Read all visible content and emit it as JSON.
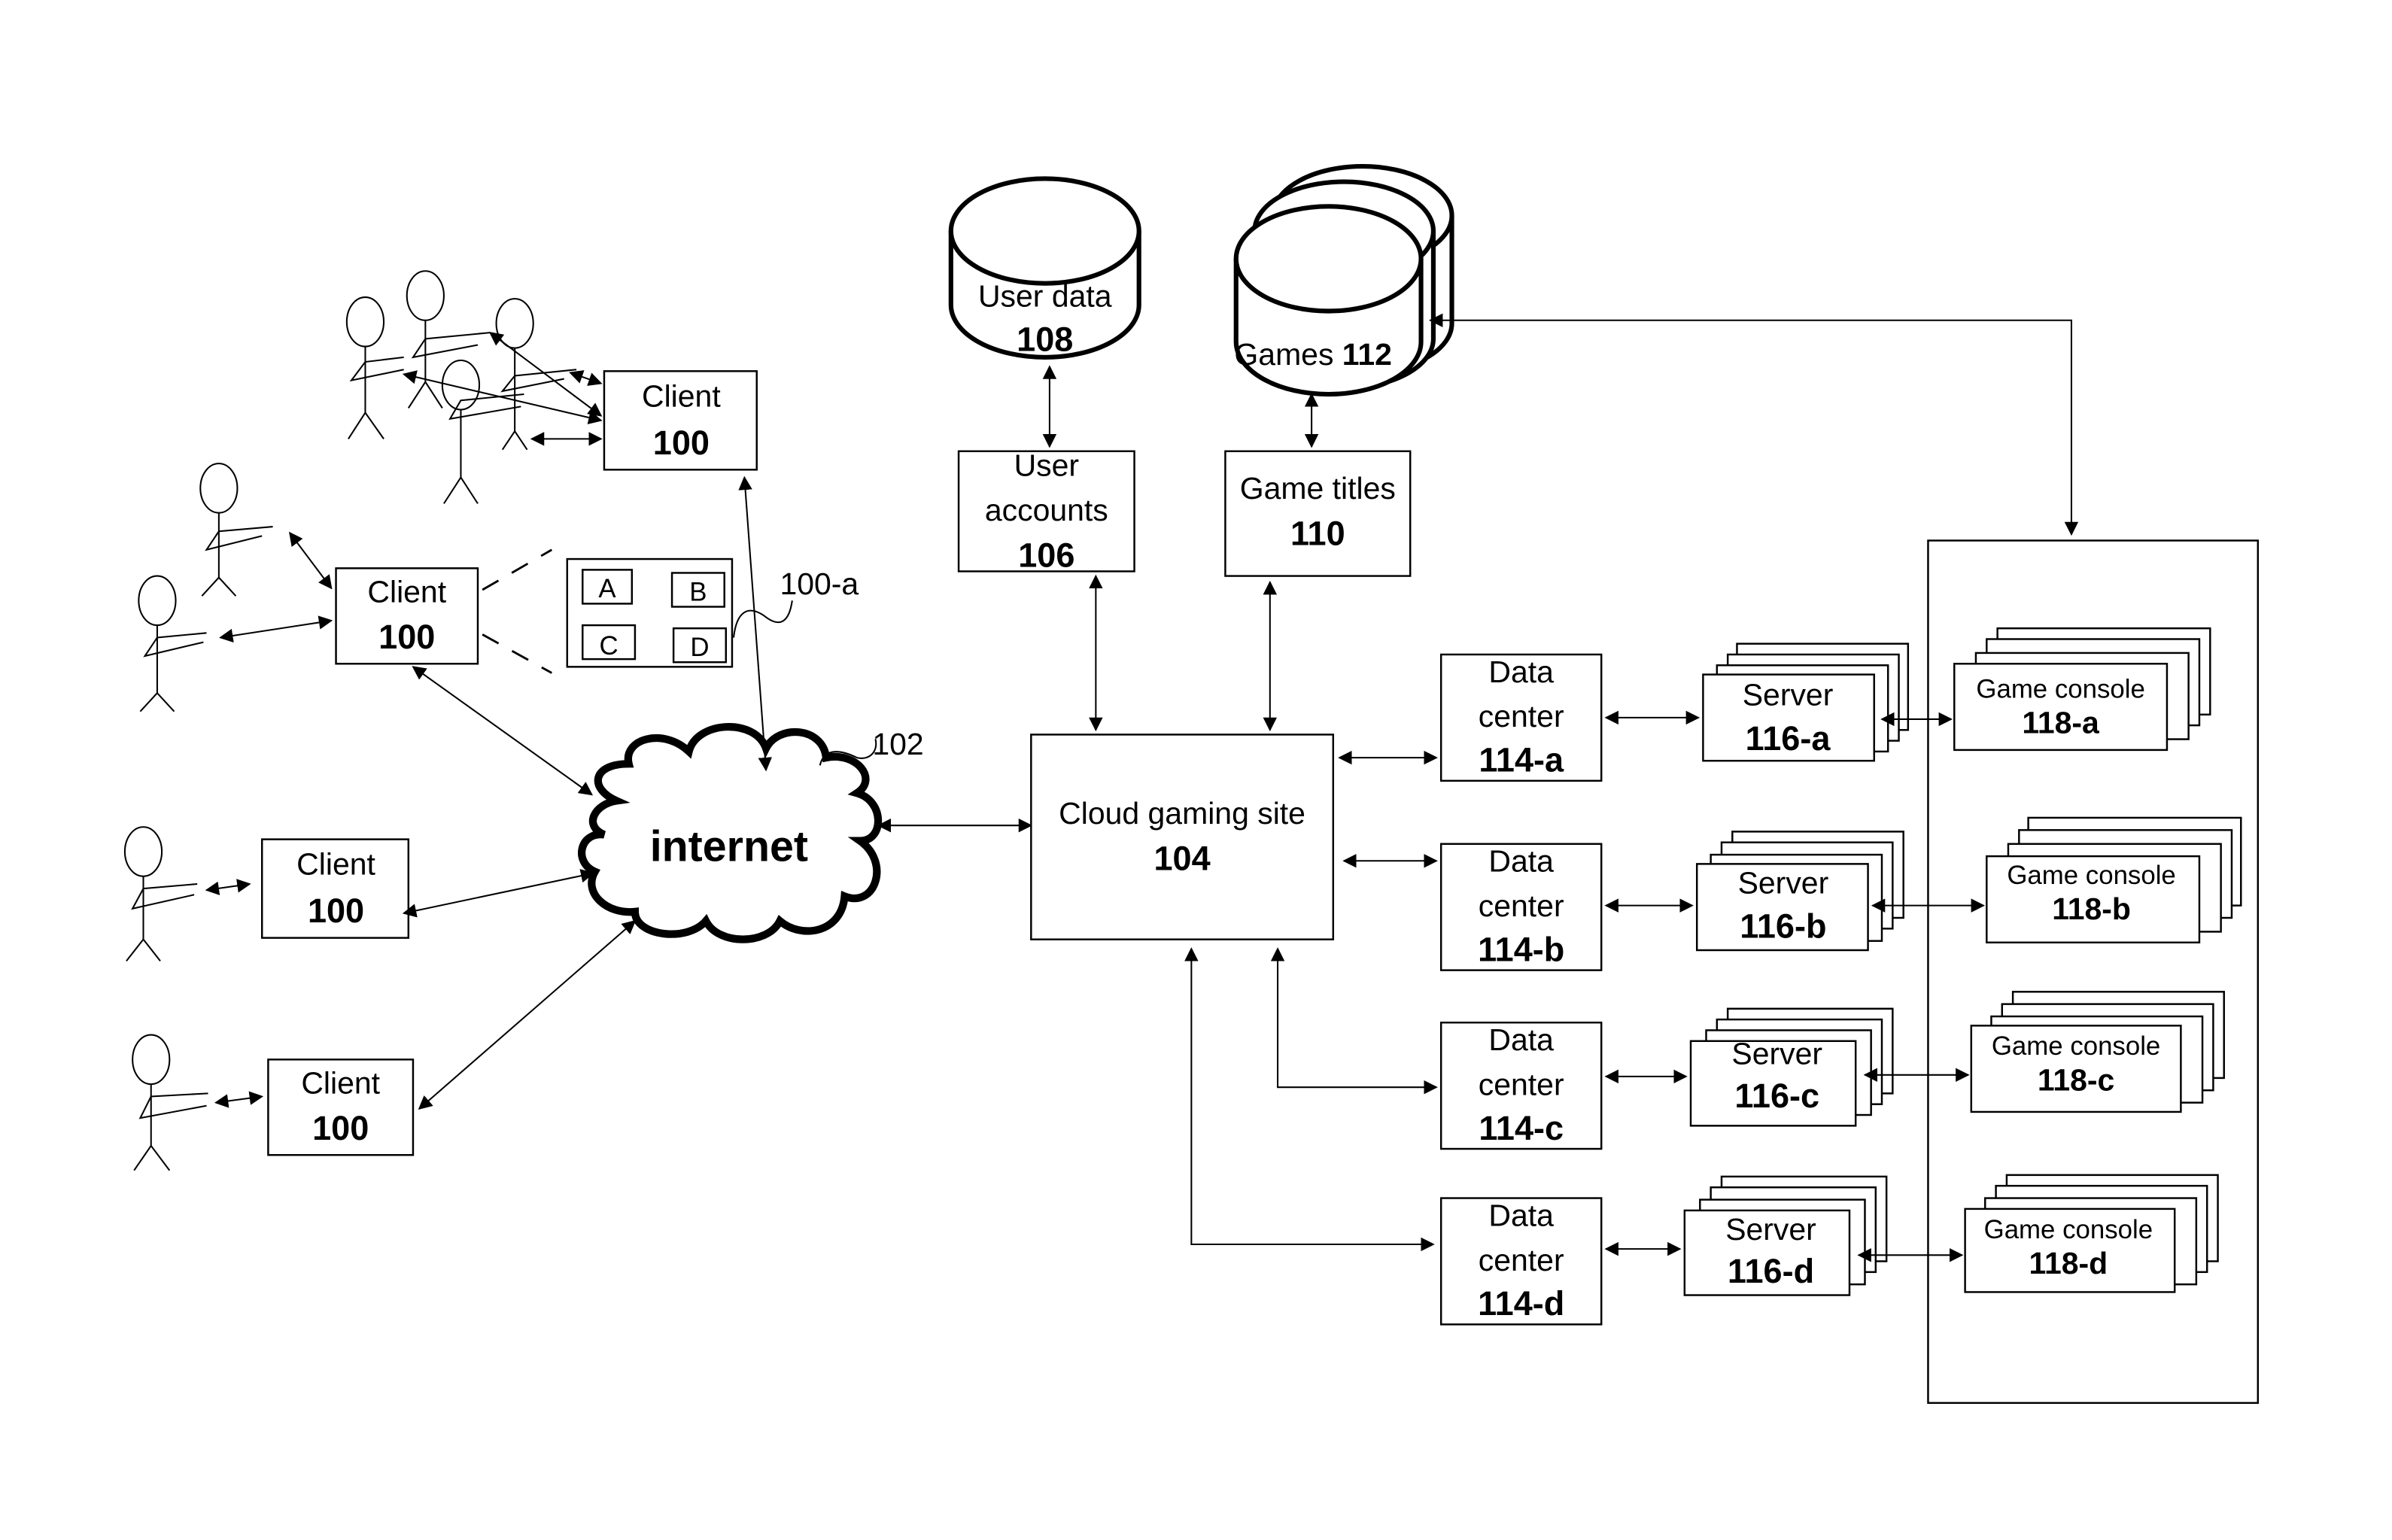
{
  "figure": {
    "clients": [
      {
        "label": "Client",
        "number": "100"
      },
      {
        "label": "Client",
        "number": "100"
      },
      {
        "label": "Client",
        "number": "100"
      },
      {
        "label": "Client",
        "number": "100"
      }
    ],
    "client_screen": {
      "tiles": [
        "A",
        "B",
        "C",
        "D"
      ],
      "ref": "100-a"
    },
    "internet": {
      "label": "internet",
      "ref": "102"
    },
    "cloud_gaming_site": {
      "label": "Cloud gaming site",
      "number": "104"
    },
    "user_accounts": {
      "line1": "User",
      "line2": "accounts",
      "number": "106"
    },
    "user_data": {
      "label": "User data",
      "number": "108"
    },
    "game_titles": {
      "label": "Game titles",
      "number": "110"
    },
    "games": {
      "label": "Games",
      "number": "112"
    },
    "data_centers": [
      {
        "line1": "Data",
        "line2": "center",
        "number": "114-a"
      },
      {
        "line1": "Data",
        "line2": "center",
        "number": "114-b"
      },
      {
        "line1": "Data",
        "line2": "center",
        "number": "114-c"
      },
      {
        "line1": "Data",
        "line2": "center",
        "number": "114-d"
      }
    ],
    "servers": [
      {
        "label": "Server",
        "number": "116-a"
      },
      {
        "label": "Server",
        "number": "116-b"
      },
      {
        "label": "Server",
        "number": "116-c"
      },
      {
        "label": "Server",
        "number": "116-d"
      }
    ],
    "game_consoles": [
      {
        "label": "Game console",
        "number": "118-a"
      },
      {
        "label": "Game console",
        "number": "118-b"
      },
      {
        "label": "Game console",
        "number": "118-c"
      },
      {
        "label": "Game console",
        "number": "118-d"
      }
    ]
  }
}
